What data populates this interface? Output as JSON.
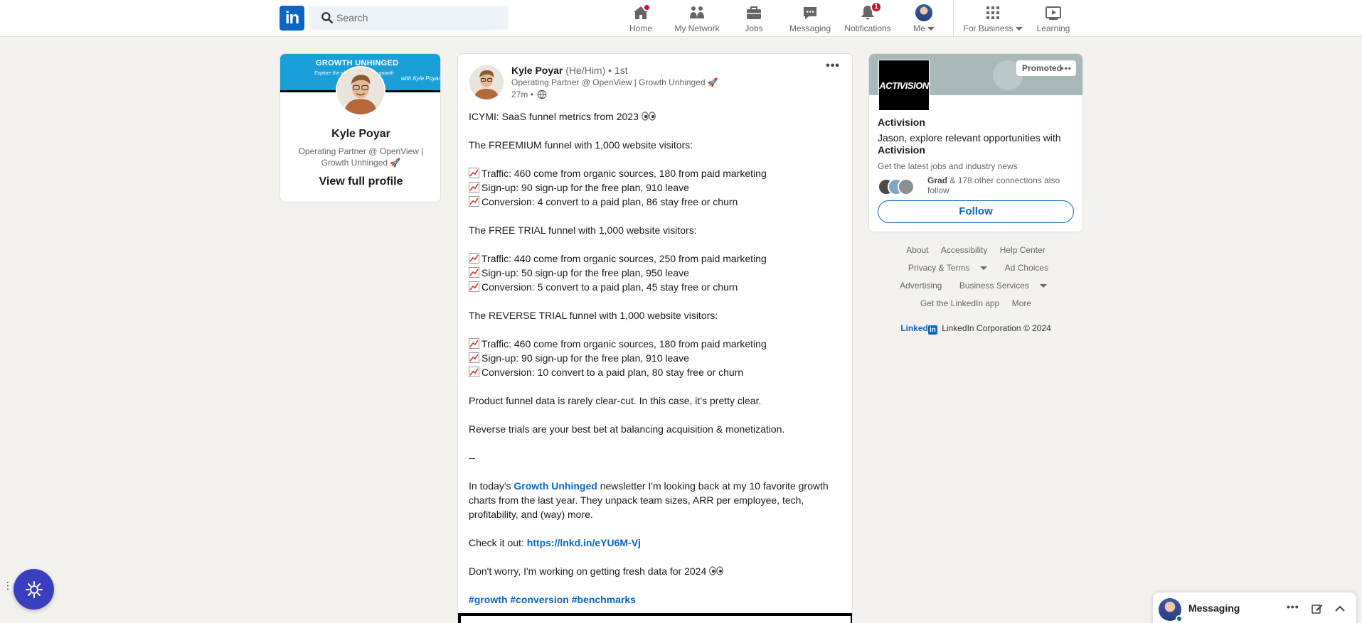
{
  "nav": {
    "logo": "in",
    "search_placeholder": "Search",
    "items": [
      {
        "label": "Home"
      },
      {
        "label": "My Network"
      },
      {
        "label": "Jobs"
      },
      {
        "label": "Messaging"
      },
      {
        "label": "Notifications",
        "badge": "1"
      },
      {
        "label": "Me"
      },
      {
        "label": "For Business"
      },
      {
        "label": "Learning"
      }
    ]
  },
  "profile": {
    "banner_title": "GROWTH UNHINGED",
    "banner_sub": "Explore the ideas behind the growth",
    "banner_sig": "with Kyle Poyar",
    "name": "Kyle Poyar",
    "headline": "Operating Partner @ OpenView | Growth Unhinged 🚀",
    "view_link": "View full profile"
  },
  "post": {
    "author": "Kyle Poyar",
    "pronouns": "(He/Him)",
    "degree": "• 1st",
    "headline": "Operating Partner @ OpenView | Growth Unhinged 🚀",
    "time": "27m •",
    "menu": "•••",
    "lines": {
      "l1": "ICYMI: SaaS funnel metrics from 2023",
      "l2": "The FREEMIUM funnel with 1,000 website visitors:",
      "l3": "Traffic: 460 come from organic sources, 180 from paid marketing",
      "l4": "Sign-up: 90 sign-up for the free plan, 910 leave",
      "l5": "Conversion: 4 convert to a paid plan, 86 stay free or churn",
      "l6": "The FREE TRIAL funnel with 1,000 website visitors:",
      "l7": "Traffic: 440 come from organic sources, 250 from paid marketing",
      "l8": "Sign-up: 50 sign-up for the free plan, 950 leave",
      "l9": "Conversion: 5 convert to a paid plan, 45 stay free or churn",
      "l10": "The REVERSE TRIAL funnel with 1,000 website visitors:",
      "l11": "Traffic: 460 come from organic sources, 180 from paid marketing",
      "l12": "Sign-up: 90 sign-up for the free plan, 910 leave",
      "l13": "Conversion: 10 convert to a paid plan, 80 stay free or churn",
      "l14": "Product funnel data is rarely clear-cut. In this case, it’s pretty clear.",
      "l15": "Reverse trials are your best bet at balancing acquisition & monetization.",
      "l16": "--",
      "l17a": "In today's ",
      "l17link": "Growth Unhinged",
      "l17b": " newsletter I'm looking back at my 10 favorite growth charts from the last year. They unpack team sizes, ARR per employee, tech, profitability, and (way) more.",
      "l18a": "Check it out: ",
      "l18link": "https://lnkd.in/eYU6M-Vj",
      "l19": "Don't worry, I'm working on getting fresh data for 2024",
      "hashtags": "#growth #conversion #benchmarks"
    }
  },
  "ad": {
    "logo_text": "ACTIVISION",
    "promoted": "Promoted",
    "promoted_menu": "•••",
    "company": "Activision",
    "text_a": "Jason, explore relevant opportunities with ",
    "text_b": "Activision",
    "sub": "Get the latest jobs and industry news",
    "conn_name": "Grad",
    "conn_rest": " & 178 other connections also follow",
    "follow": "Follow"
  },
  "footer": {
    "row1": [
      "About",
      "Accessibility",
      "Help Center"
    ],
    "row2": [
      "Privacy & Terms",
      "Ad Choices"
    ],
    "row3": [
      "Advertising",
      "Business Services"
    ],
    "row4": [
      "Get the LinkedIn app",
      "More"
    ],
    "brand_word": "Linked",
    "brand_in": "in",
    "copyright": "LinkedIn Corporation © 2024"
  },
  "messaging": {
    "label": "Messaging",
    "menu": "•••"
  },
  "colors": {
    "brand": "#0a66c2",
    "badge": "#cb112d",
    "background": "#f4f2ee"
  }
}
